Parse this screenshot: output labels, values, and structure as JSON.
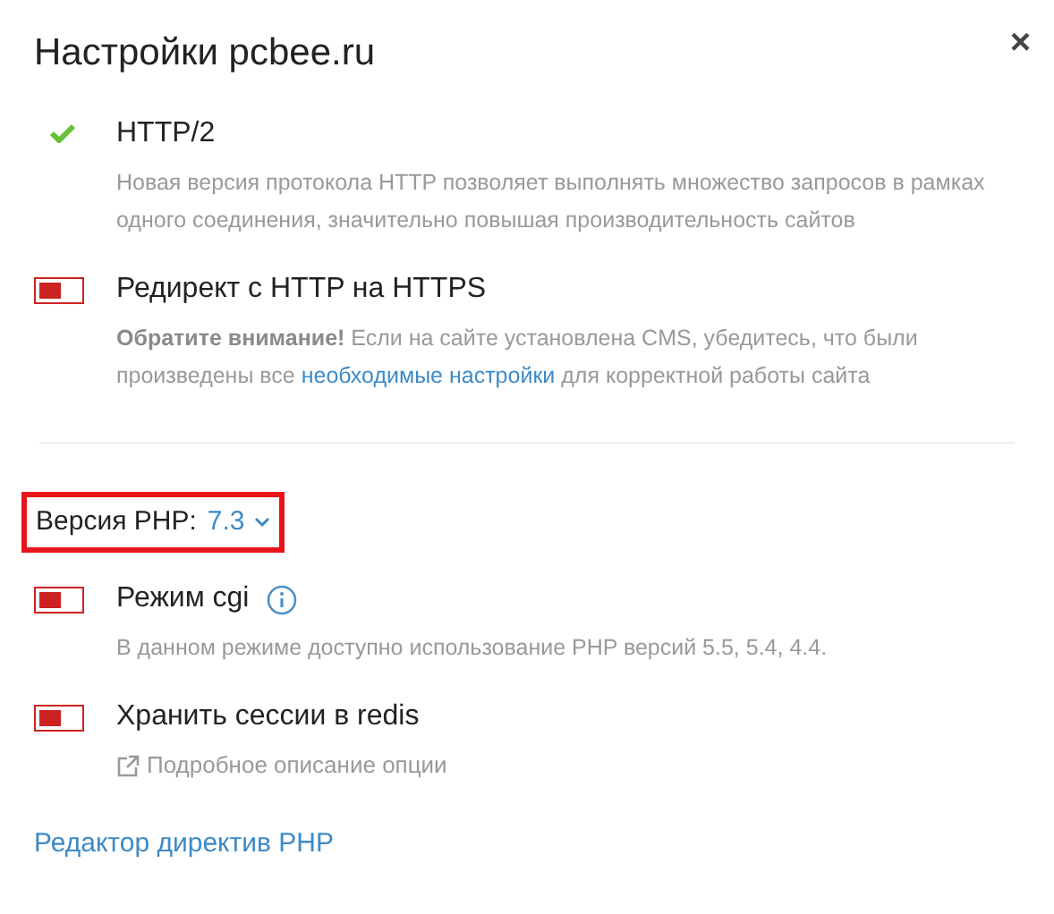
{
  "title": "Настройки pcbee.ru",
  "close": "×",
  "options": [
    {
      "kind": "check",
      "checked": true,
      "label": "HTTP/2",
      "description": [
        {
          "text": "Новая версия протокола HTTP позволяет выполнять множество запросов в рамках одного соединения, значительно повышая производительность сайтов"
        }
      ]
    },
    {
      "kind": "toggle",
      "on": false,
      "label": "Редирект с HTTP на HTTPS",
      "description": [
        {
          "text": "**Обратите внимание!** Если на сайте установлена CMS, убедитесь, что были произведены все "
        },
        {
          "link": "необходимые настройки"
        },
        {
          "text": " для корректной работы сайта"
        }
      ]
    }
  ],
  "php_version": {
    "label": "Версия PHP:",
    "value": "7.3",
    "highlighted": true
  },
  "php_options": [
    {
      "kind": "toggle",
      "on": false,
      "label": "Режим cgi",
      "info": true,
      "description": [
        {
          "text": "В данном режиме доступно использование PHP версий 5.5, 5.4, 4.4."
        }
      ]
    },
    {
      "kind": "toggle",
      "on": false,
      "label": "Хранить сессии в redis",
      "external_link": "Подробное описание опции"
    }
  ],
  "footer_link": "Редактор директив PHP"
}
